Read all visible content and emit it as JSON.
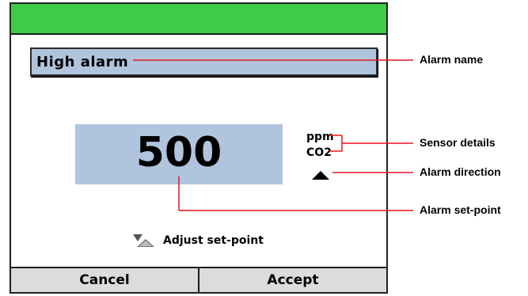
{
  "screen": {
    "alarm_name": "High alarm",
    "set_point": "500",
    "sensor_unit": "ppm",
    "sensor_gas": "CO2",
    "alarm_direction_icon": "triangle-up-icon",
    "adjust_icon": "up-down-triangles-icon",
    "adjust_label": "Adjust set-point",
    "cancel_label": "Cancel",
    "accept_label": "Accept"
  },
  "callouts": {
    "alarm_name": "Alarm name",
    "sensor_details": "Sensor details",
    "alarm_direction": "Alarm direction",
    "alarm_set_point": "Alarm set-point"
  },
  "colors": {
    "header_green": "#3dcc45",
    "field_blue": "#b0c4dd",
    "callout_line": "#e8141e",
    "button_gray": "#dcdcdc"
  }
}
